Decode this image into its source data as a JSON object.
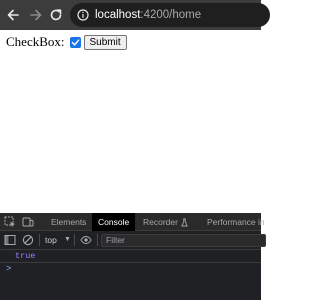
{
  "browser": {
    "url_host": "localhost",
    "url_path": ":4200/home"
  },
  "page": {
    "checkbox_label": "CheckBox:",
    "checkbox_checked": true,
    "submit_label": "Submit"
  },
  "devtools": {
    "tabs": [
      "Elements",
      "Console",
      "Recorder",
      "Performance in"
    ],
    "active_tab": "Console",
    "context": "top",
    "filter_placeholder": "Filter",
    "log_value": "true",
    "prompt": ">"
  }
}
